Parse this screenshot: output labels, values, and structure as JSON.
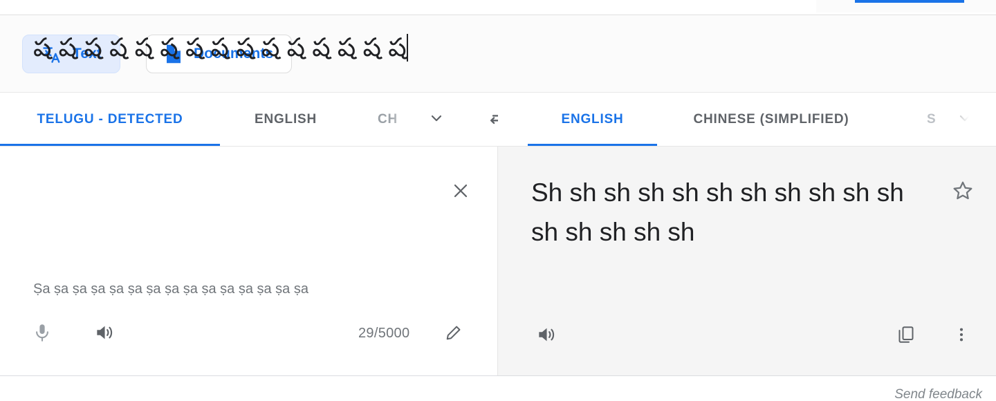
{
  "mode_bar": {
    "text_tab": {
      "label": "Text",
      "icon": "translate-icon",
      "active": true
    },
    "documents_tab": {
      "label": "Documents",
      "icon": "document-icon",
      "active": false
    }
  },
  "source_panel": {
    "tabs": [
      {
        "label": "TELUGU - DETECTED",
        "active": true
      },
      {
        "label": "ENGLISH",
        "active": false
      },
      {
        "label": "CH",
        "active": false,
        "truncated": true
      }
    ],
    "more_languages_icon": "chevron-down-icon",
    "text": "ష ష ష ష ష ష ష ష ష ష ష ష ష ష ష",
    "transliteration": "Ṣa ṣa ṣa ṣa ṣa ṣa ṣa ṣa ṣa ṣa ṣa ṣa ṣa ṣa ṣa",
    "clear_icon": "close-icon",
    "char_count": "29/5000",
    "microphone_icon": "microphone-icon",
    "listen_icon": "speaker-icon",
    "edit_icon": "pencil-icon"
  },
  "swap_languages_icon": "swap-horizontal-icon",
  "target_panel": {
    "tabs": [
      {
        "label": "ENGLISH",
        "active": true
      },
      {
        "label": "CHINESE (SIMPLIFIED)",
        "active": false
      },
      {
        "label": "S",
        "active": false,
        "truncated": true
      }
    ],
    "more_languages_icon": "chevron-down-icon",
    "text": "Sh sh sh sh sh sh sh sh sh sh sh sh sh sh sh sh",
    "star_icon": "star-outline-icon",
    "listen_icon": "speaker-icon",
    "copy_icon": "copy-icon",
    "more_options_icon": "more-vert-icon"
  },
  "footer": {
    "send_feedback_label": "Send feedback"
  },
  "colors": {
    "accent_blue": "#1a73e8",
    "active_pill_bg": "#e3ecfd",
    "panel_gray": "#f5f5f5",
    "muted_text": "#5f6368",
    "body_text": "#202124"
  }
}
